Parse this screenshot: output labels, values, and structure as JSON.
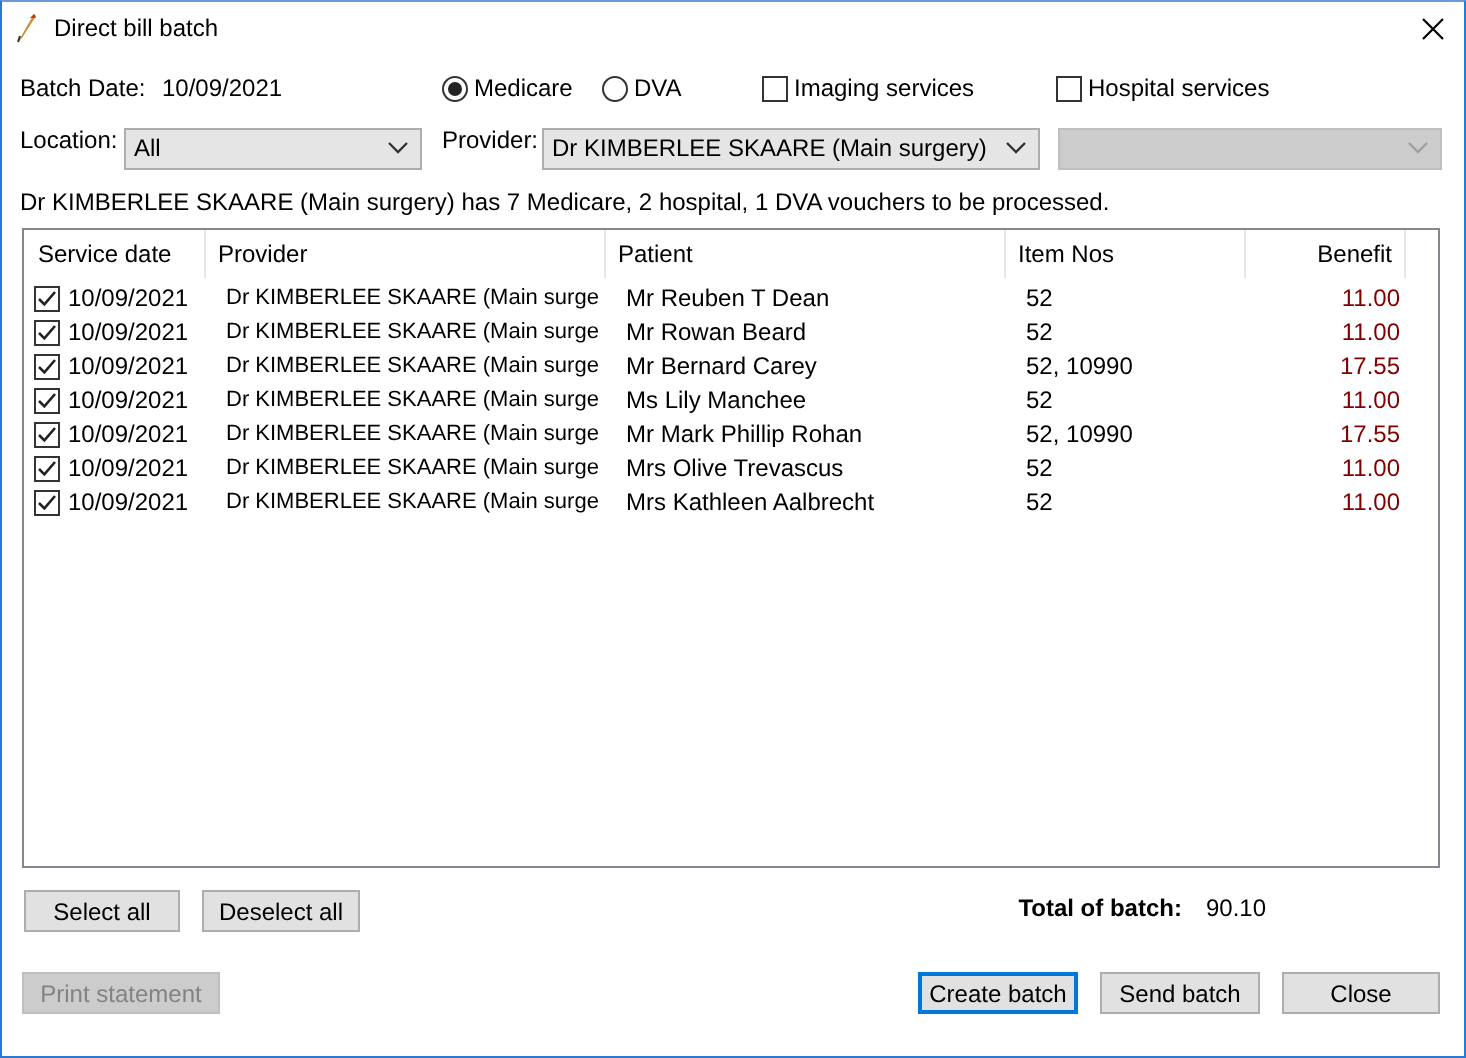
{
  "window": {
    "title": "Direct bill batch"
  },
  "batch_date": {
    "label": "Batch Date:",
    "value": "10/09/2021"
  },
  "voucher_type": [
    {
      "label": "Medicare",
      "selected": true
    },
    {
      "label": "DVA",
      "selected": false
    }
  ],
  "options": [
    {
      "label": "Imaging services",
      "checked": false
    },
    {
      "label": "Hospital services",
      "checked": false
    }
  ],
  "location": {
    "label": "Location:",
    "value": "All"
  },
  "provider": {
    "label": "Provider:",
    "value": "Dr KIMBERLEE SKAARE (Main surgery)"
  },
  "extra_select": {
    "disabled": true
  },
  "message": "Dr KIMBERLEE SKAARE (Main surgery) has 7 Medicare, 2 hospital, 1 DVA vouchers to be processed.",
  "table": {
    "columns": [
      "Service date",
      "Provider",
      "Patient",
      "Item Nos",
      "Benefit"
    ],
    "rows": [
      {
        "checked": true,
        "service_date": "10/09/2021",
        "provider": "Dr KIMBERLEE SKAARE (Main surge",
        "patient": "Mr Reuben T Dean",
        "item_nos": "52",
        "benefit": "11.00"
      },
      {
        "checked": true,
        "service_date": "10/09/2021",
        "provider": "Dr KIMBERLEE SKAARE (Main surge",
        "patient": "Mr Rowan Beard",
        "item_nos": "52",
        "benefit": "11.00"
      },
      {
        "checked": true,
        "service_date": "10/09/2021",
        "provider": "Dr KIMBERLEE SKAARE (Main surge",
        "patient": "Mr Bernard Carey",
        "item_nos": "52, 10990",
        "benefit": "17.55"
      },
      {
        "checked": true,
        "service_date": "10/09/2021",
        "provider": "Dr KIMBERLEE SKAARE (Main surge",
        "patient": "Ms Lily Manchee",
        "item_nos": "52",
        "benefit": "11.00"
      },
      {
        "checked": true,
        "service_date": "10/09/2021",
        "provider": "Dr KIMBERLEE SKAARE (Main surge",
        "patient": "Mr Mark Phillip Rohan",
        "item_nos": "52, 10990",
        "benefit": "17.55"
      },
      {
        "checked": true,
        "service_date": "10/09/2021",
        "provider": "Dr KIMBERLEE SKAARE (Main surge",
        "patient": "Mrs Olive Trevascus",
        "item_nos": "52",
        "benefit": "11.00"
      },
      {
        "checked": true,
        "service_date": "10/09/2021",
        "provider": "Dr KIMBERLEE SKAARE (Main surge",
        "patient": "Mrs Kathleen Aalbrecht",
        "item_nos": "52",
        "benefit": "11.00"
      }
    ]
  },
  "list_buttons": [
    "Select all",
    "Deselect all"
  ],
  "total": {
    "label": "Total of batch:",
    "value": "90.10"
  },
  "footer_buttons": [
    {
      "label": "Print statement",
      "disabled": true,
      "focused": false
    },
    {
      "label": "Create batch",
      "disabled": false,
      "focused": true
    },
    {
      "label": "Send batch",
      "disabled": false,
      "focused": false
    },
    {
      "label": "Close",
      "disabled": false,
      "focused": false
    }
  ]
}
